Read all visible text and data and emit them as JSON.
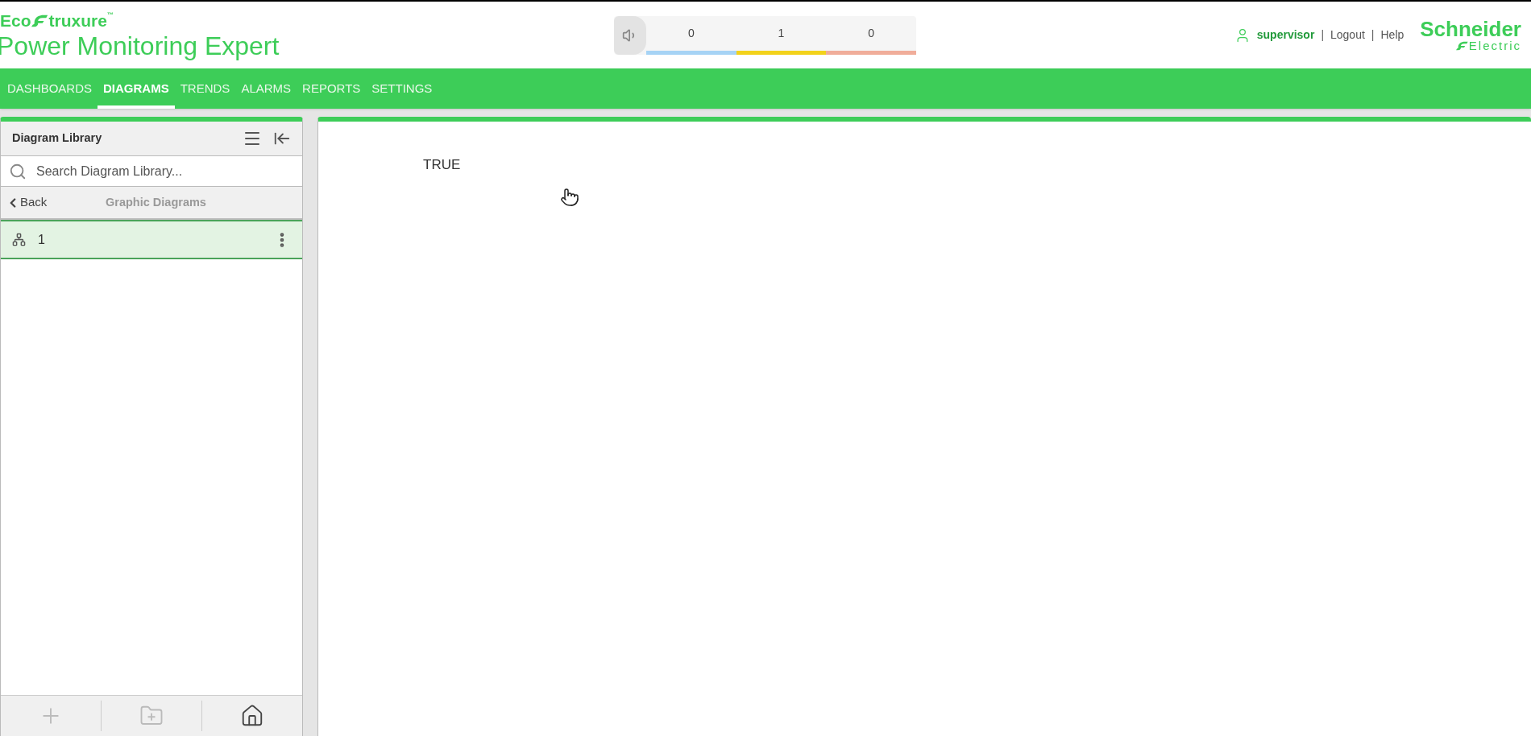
{
  "header": {
    "brand_prefix": "Eco",
    "brand_suffix": "truxure",
    "brand_mark": "™",
    "product": "Power Monitoring Expert",
    "alarm_counts": [
      {
        "count": "0",
        "color": "#a6d3f5"
      },
      {
        "count": "1",
        "color": "#f2d21b"
      },
      {
        "count": "0",
        "color": "#f0ad9a"
      }
    ],
    "user": "supervisor",
    "separator": "|",
    "links": [
      "Logout",
      "Help"
    ],
    "company_top": "Schneider",
    "company_bottom": "Electric"
  },
  "nav": [
    {
      "label": "DASHBOARDS",
      "selected": false
    },
    {
      "label": "DIAGRAMS",
      "selected": true
    },
    {
      "label": "TRENDS",
      "selected": false
    },
    {
      "label": "ALARMS",
      "selected": false
    },
    {
      "label": "REPORTS",
      "selected": false
    },
    {
      "label": "SETTINGS",
      "selected": false
    }
  ],
  "library": {
    "title": "Diagram Library",
    "search": {
      "placeholder": "Search Diagram Library..."
    },
    "back": "Back",
    "path": "Graphic Diagrams",
    "items": [
      {
        "label": "1",
        "selected": true
      }
    ],
    "footer": [
      {
        "kind": "add",
        "disabled": true
      },
      {
        "kind": "new-folder",
        "disabled": true
      },
      {
        "kind": "home",
        "disabled": false
      }
    ]
  },
  "content": {
    "text": "TRUE"
  }
}
